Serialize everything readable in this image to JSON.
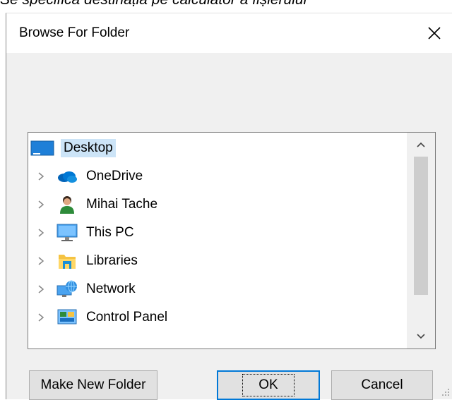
{
  "background_caption": "Se specifică destinația pe calculator a fișierului",
  "dialog": {
    "title": "Browse For Folder",
    "close_glyph": "✕"
  },
  "tree": {
    "items": [
      {
        "label": "Desktop",
        "icon": "desktop-icon",
        "selected": true,
        "expandable": false
      },
      {
        "label": "OneDrive",
        "icon": "onedrive-cloud-icon",
        "expandable": true
      },
      {
        "label": "Mihai Tache",
        "icon": "user-folder-icon",
        "expandable": true
      },
      {
        "label": "This PC",
        "icon": "this-pc-icon",
        "expandable": true
      },
      {
        "label": "Libraries",
        "icon": "libraries-icon",
        "expandable": true
      },
      {
        "label": "Network",
        "icon": "network-icon",
        "expandable": true
      },
      {
        "label": "Control Panel",
        "icon": "control-panel-icon",
        "expandable": true
      }
    ]
  },
  "buttons": {
    "make_new_folder": "Make New Folder",
    "ok": "OK",
    "cancel": "Cancel"
  },
  "colors": {
    "dialog_bg": "#f0f0f0",
    "selection": "#cce4f7",
    "accent": "#0078d7"
  }
}
